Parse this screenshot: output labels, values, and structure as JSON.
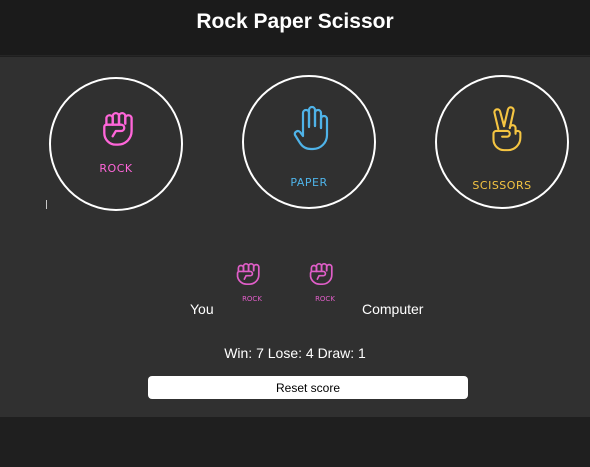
{
  "header": {
    "title": "Rock Paper Scissor"
  },
  "choices": [
    {
      "id": "rock",
      "label": "ROCK",
      "icon": "fist-icon",
      "color": "#ff66d9"
    },
    {
      "id": "paper",
      "label": "PAPER",
      "icon": "open-hand-icon",
      "color": "#4fb3e8"
    },
    {
      "id": "scissors",
      "label": "SCISSORS",
      "icon": "peace-hand-icon",
      "color": "#f5c542"
    }
  ],
  "result": {
    "player_label": "You",
    "computer_label": "Computer",
    "player_pick": "ROCK",
    "computer_pick": "ROCK",
    "pick_color": "#e05ec8"
  },
  "score": {
    "text": "Win: 7 Lose: 4 Draw: 1",
    "win": 7,
    "lose": 4,
    "draw": 1
  },
  "reset_label": "Reset score",
  "colors": {
    "header_bg": "#1b1b1b",
    "main_bg": "#303030",
    "page_bg": "#1f1f1f"
  }
}
